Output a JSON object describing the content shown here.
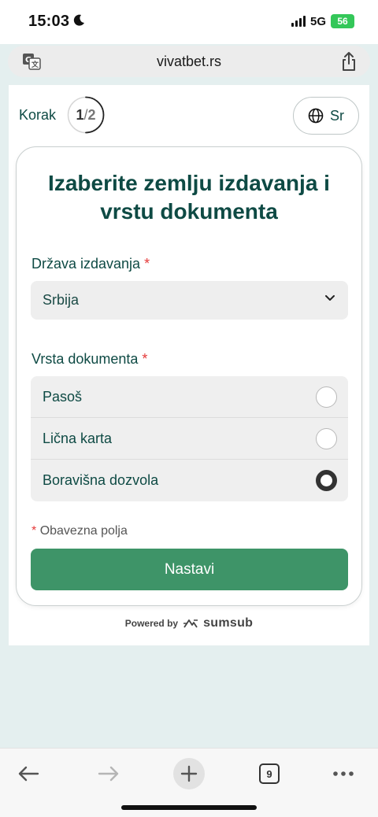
{
  "status": {
    "time": "15:03",
    "network": "5G",
    "battery": "56"
  },
  "browser": {
    "url": "vivatbet.rs",
    "tabs_count": "9"
  },
  "step": {
    "label": "Korak",
    "current": "1",
    "separator": "/",
    "total": "2",
    "progress": 0.5
  },
  "language": {
    "label": "Sr"
  },
  "form": {
    "title": "Izaberite zemlju izdavanja i vrstu dokumenta",
    "country_label": "Država izdavanja",
    "required_mark": "*",
    "country_value": "Srbija",
    "doc_label": "Vrsta dokumenta",
    "doc_options": [
      {
        "label": "Pasoš",
        "selected": false
      },
      {
        "label": "Lična karta",
        "selected": false
      },
      {
        "label": "Boravišna dozvola",
        "selected": true
      }
    ],
    "required_note": "Obavezna polja",
    "submit_label": "Nastavi"
  },
  "footer": {
    "powered_by": "Powered by",
    "brand": "sumsub"
  },
  "colors": {
    "primary_green": "#3e9468",
    "heading": "#0e4a44",
    "required": "#e53a3a"
  },
  "icons": [
    "moon-icon",
    "signal-icon",
    "translate-icon",
    "share-icon",
    "globe-icon",
    "chevron-down-icon",
    "back-arrow-icon",
    "forward-arrow-icon",
    "plus-icon",
    "tabs-icon",
    "more-icon",
    "sumsub-logo-icon"
  ]
}
